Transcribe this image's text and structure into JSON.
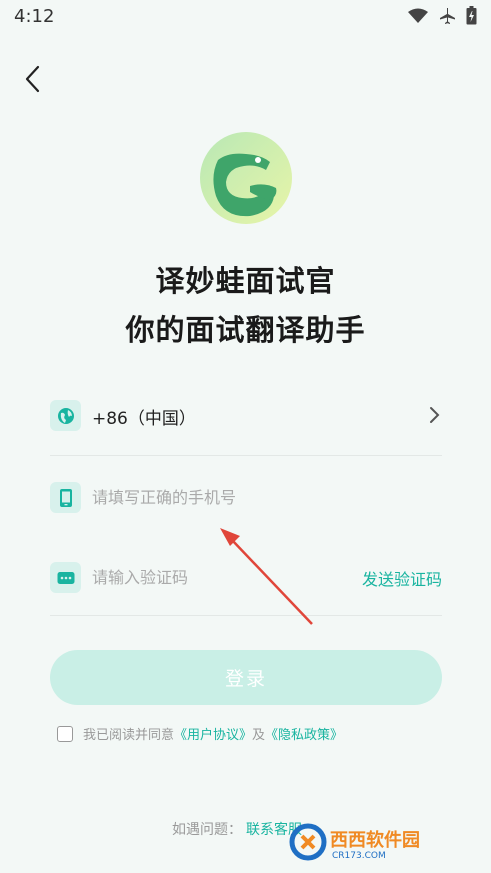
{
  "status_bar": {
    "time": "4:12"
  },
  "app": {
    "title_line1": "译妙蛙面试官",
    "title_line2": "你的面试翻译助手"
  },
  "form": {
    "country_code": "+86（中国）",
    "phone_placeholder": "请填写正确的手机号",
    "code_placeholder": "请输入验证码",
    "send_code_label": "发送验证码",
    "login_label": "登录"
  },
  "agreement": {
    "prefix": "我已阅读并同意",
    "user_agreement": "《用户协议》",
    "conjunction": "及",
    "privacy_policy": "《隐私政策》"
  },
  "footer": {
    "question": "如遇问题：",
    "contact": "联系客服"
  },
  "watermark": {
    "brand": "西西软件园",
    "site": "CR173.COM"
  },
  "colors": {
    "accent": "#19b4a0",
    "icon_bg": "#d8f1ec",
    "login_bg": "#c9efe6",
    "page_bg": "#f3f8f6"
  }
}
